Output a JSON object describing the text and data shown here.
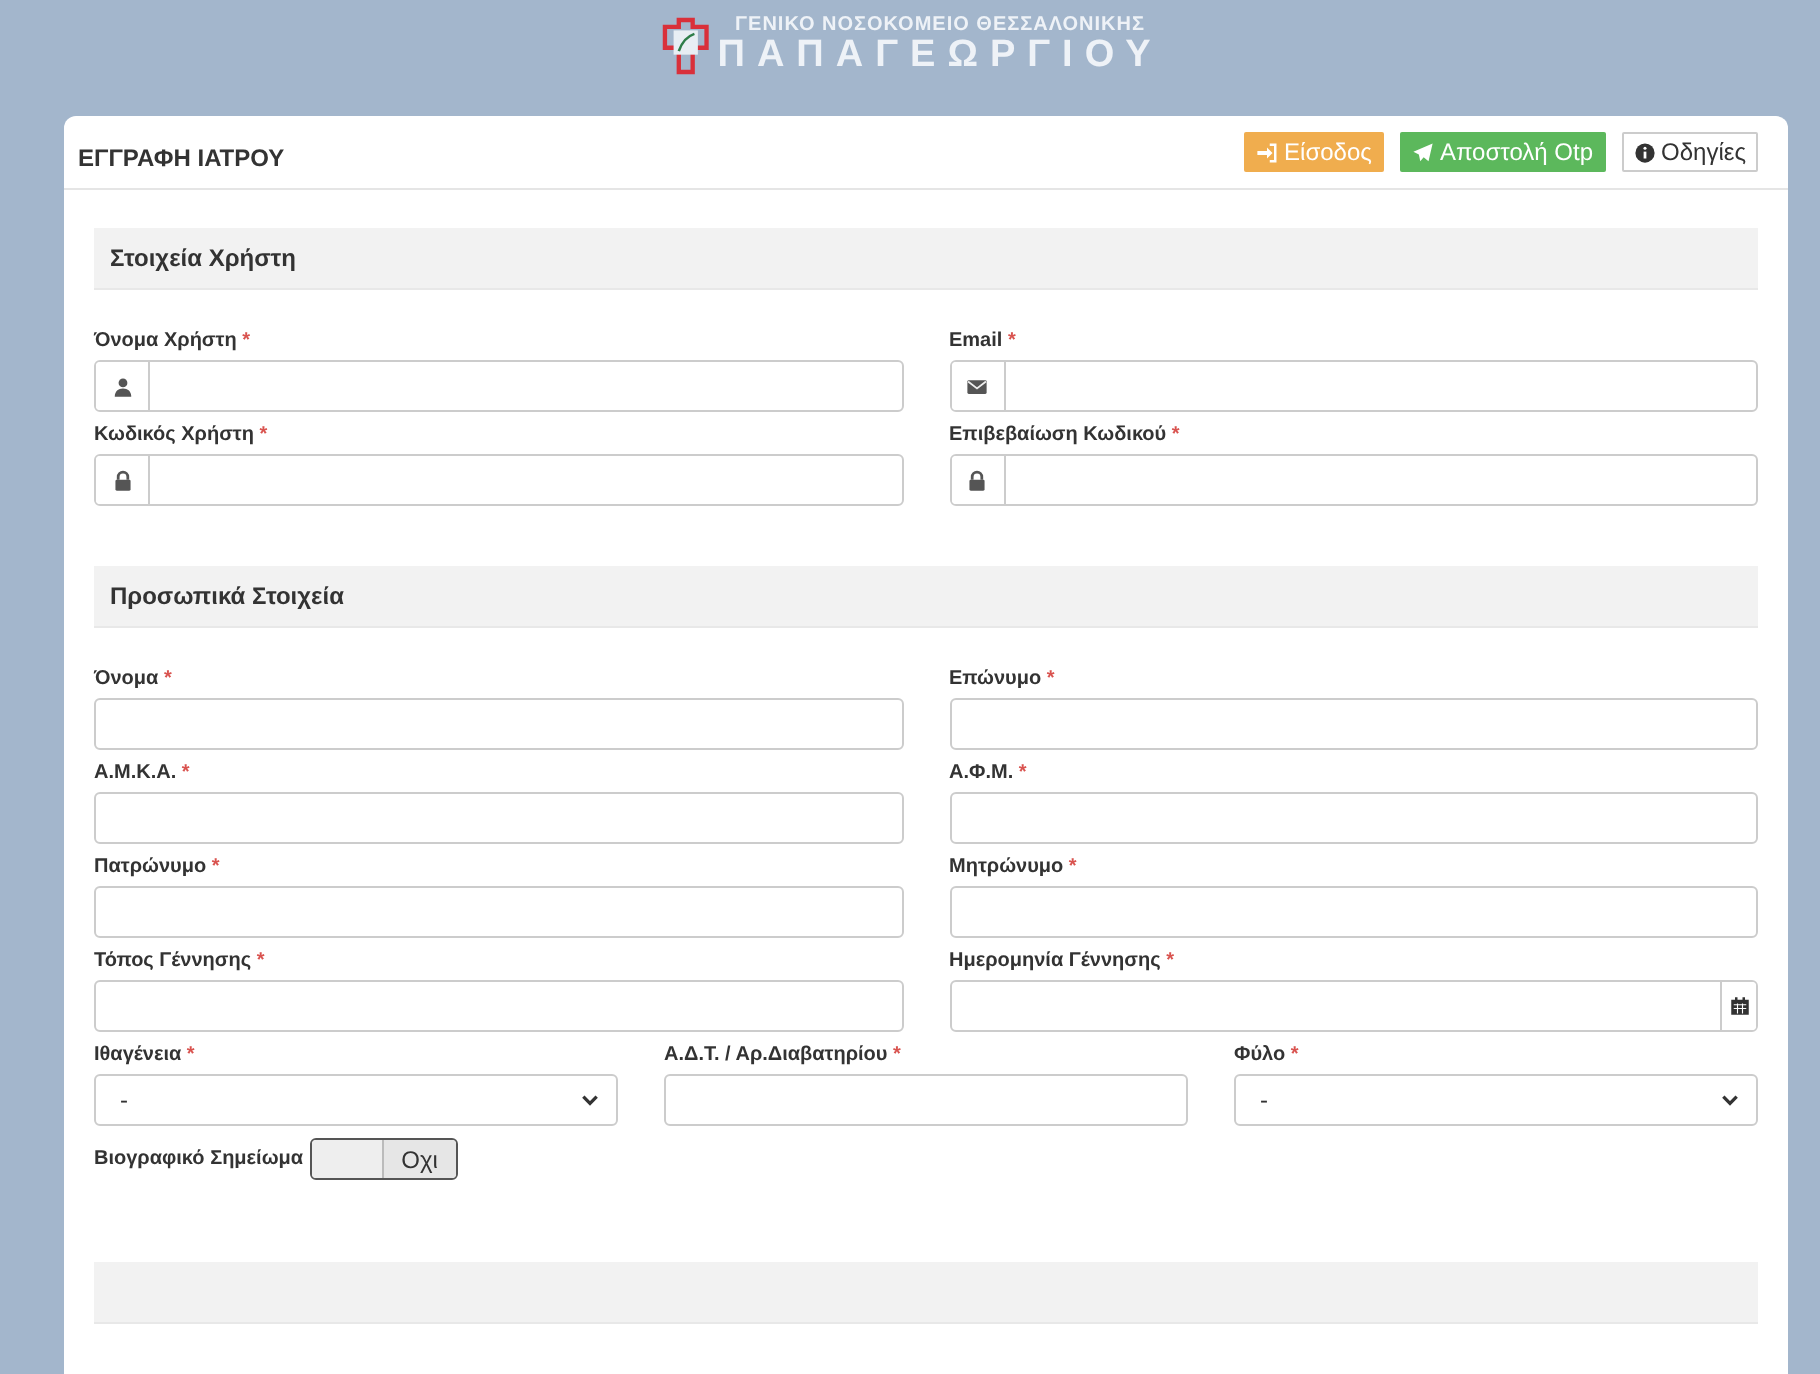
{
  "banner": {
    "line_1": "ΓΕΝΙΚΟ ΝΟΣΟΚΟΜΕΙΟ ΘΕΣΣΑΛΟΝΙΚΗΣ",
    "line_2": "ΠΑΠΑΓΕΩΡΓΙΟΥ"
  },
  "card": {
    "title": "ΕΓΓΡΑΦΗ ΙΑΤΡΟΥ",
    "buttons": [
      {
        "label": "Είσοδος",
        "kind": "login"
      },
      {
        "label": "Αποστολή Otp",
        "kind": "send"
      },
      {
        "label": "Οδηγίες",
        "kind": "info"
      }
    ]
  },
  "sections": [
    {
      "title": "Στοιχεία Χρήστη",
      "rows": [
        [
          {
            "label": "Όνομα Χρήστη",
            "mark": "*",
            "kind": "username"
          },
          {
            "label": "Email",
            "mark": "*",
            "kind": "email"
          }
        ],
        [
          {
            "label": "Κωδικός Χρήστη",
            "mark": "*",
            "kind": "password"
          },
          {
            "label": "Επιβεβαίωση Κωδικού",
            "mark": "*",
            "kind": "password"
          }
        ]
      ]
    },
    {
      "title": "Προσωπικά Στοιχεία",
      "rows": [
        [
          {
            "label": "Όνομα",
            "mark": "*",
            "kind": "input"
          },
          {
            "label": "Επώνυμο",
            "mark": "*",
            "kind": "input"
          }
        ],
        [
          {
            "label": "Α.Μ.Κ.Α.",
            "mark": "*",
            "kind": "input"
          },
          {
            "label": "Α.Φ.Μ.",
            "mark": "*",
            "kind": "input"
          }
        ],
        [
          {
            "label": "Πατρώνυμο",
            "mark": "*",
            "kind": "input"
          },
          {
            "label": "Μητρώνυμο",
            "mark": "*",
            "kind": "input"
          }
        ],
        [
          {
            "label": "Τόπος Γέννησης",
            "mark": "*",
            "kind": "input"
          },
          {
            "label": "Ημερομηνία Γέννησης",
            "mark": "*",
            "kind": "date"
          }
        ],
        [
          {
            "label": "Ιθαγένεια",
            "mark": "*",
            "kind": "select",
            "value": "-"
          },
          {
            "label": "Α.Δ.Τ. / Αρ.Διαβατηρίου",
            "mark": "*",
            "kind": "input"
          },
          {
            "label": "Φύλο",
            "mark": "*",
            "kind": "select",
            "value": "-"
          }
        ]
      ],
      "toggle": {
        "label": "Βιογραφικό Σημείωμα",
        "on": false,
        "state_text": "Οχι"
      }
    }
  ]
}
